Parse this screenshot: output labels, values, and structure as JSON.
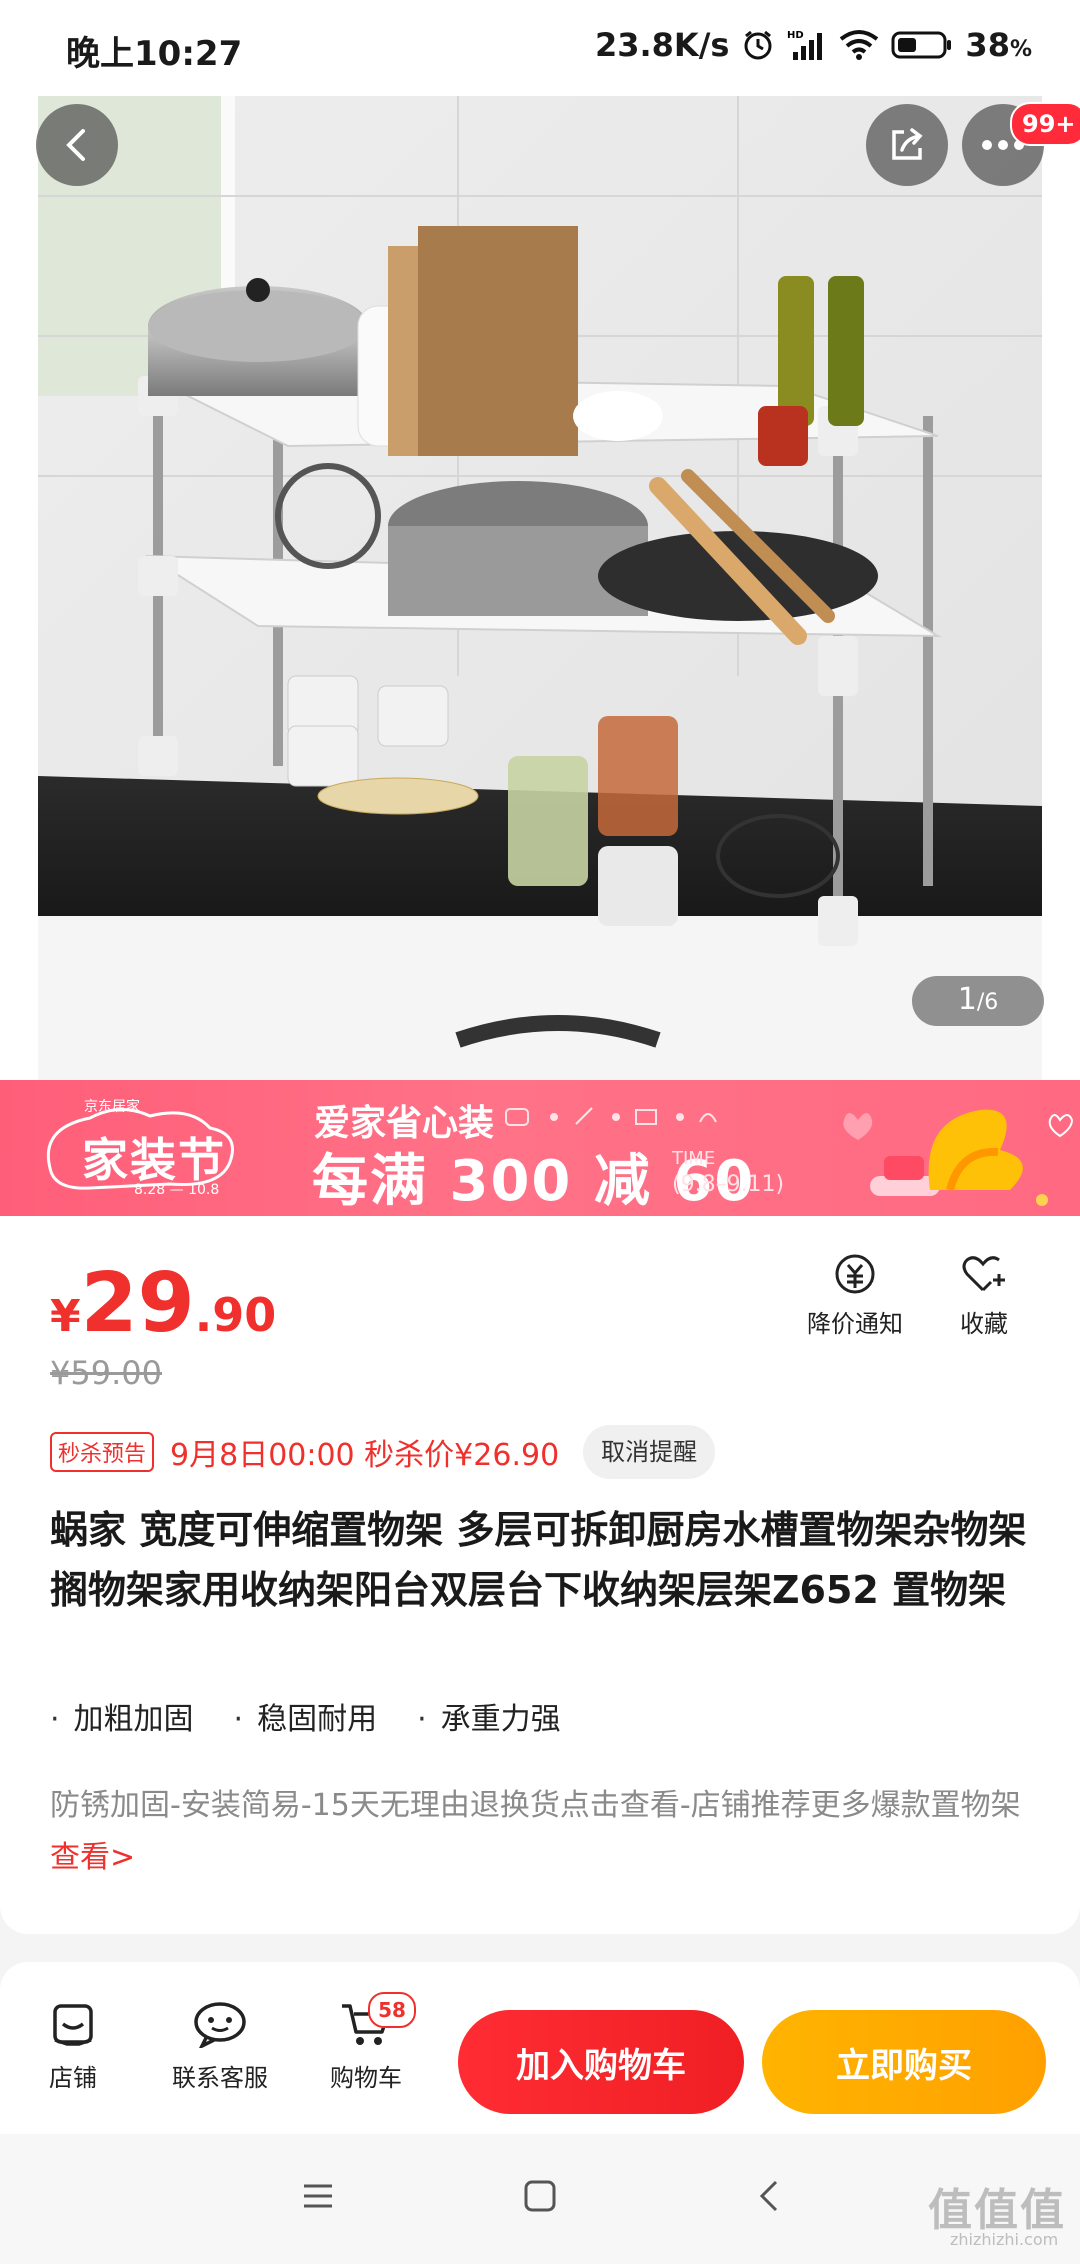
{
  "status_bar": {
    "time": "晚上10:27",
    "network_speed": "23.8K/s",
    "battery": "38",
    "battery_unit": "%",
    "icons": [
      "alarm-icon",
      "hd-signal-icon",
      "wifi-icon",
      "battery-icon"
    ]
  },
  "gallery": {
    "current": "1",
    "total": "/6",
    "more_badge": "99+",
    "icons": [
      "back-icon",
      "share-icon",
      "more-icon"
    ]
  },
  "banner": {
    "small_brand": "京东居家",
    "festival": "家装节",
    "dates": "8.28 — 10.8",
    "slogan": "爱家省心装",
    "main": "每满 300 减 60",
    "time_label": "TIME",
    "time_range": "(9.8–9.11)"
  },
  "product": {
    "price_symbol": "¥",
    "price_int": "29",
    "price_dec": ".90",
    "original_price": "¥59.00",
    "actions": {
      "notify": "降价通知",
      "favorite": "收藏"
    },
    "flash_tag": "秒杀预告",
    "flash_text": "9月8日00:00 秒杀价¥26.90",
    "remind_button": "取消提醒",
    "title": "蜗家 宽度可伸缩置物架 多层可拆卸厨房水槽置物架杂物架搁物架家用收纳架阳台双层台下收纳架层架Z652 置物架",
    "features": [
      "加粗加固",
      "稳固耐用",
      "承重力强"
    ],
    "description": "防锈加固-安装简易-15天无理由退换货点击查看-店铺推荐更多爆款置物架 ",
    "description_link": "查看>"
  },
  "action_bar": {
    "shop": "店铺",
    "service": "联系客服",
    "cart": "购物车",
    "cart_count": "58",
    "add_to_cart": "加入购物车",
    "buy_now": "立即购买"
  },
  "watermark": {
    "main": "值值值",
    "sub": "zhizhizhi.com"
  },
  "colors": {
    "accent_red": "#f0302c",
    "buy_orange": "#ffa800",
    "banner_pink": "#ff6a82"
  }
}
